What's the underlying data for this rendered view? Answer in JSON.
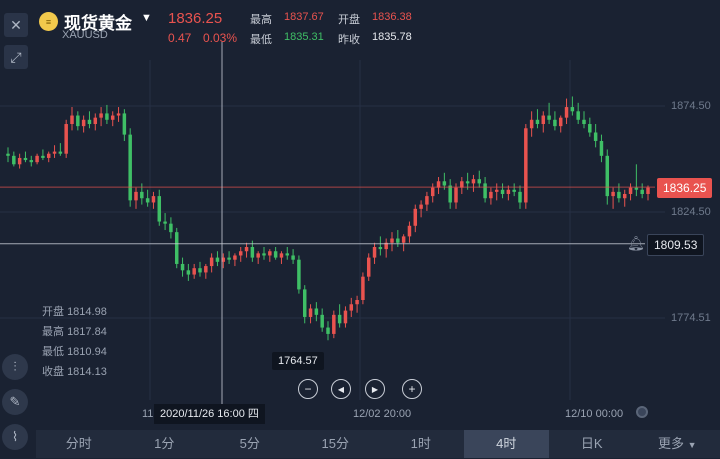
{
  "header": {
    "title": "现货黄金",
    "symbol": "XAUUSD",
    "price": "1836.25",
    "change": "0.47",
    "change_pct": "0.03%",
    "high_label": "最高",
    "high_value": "1837.67",
    "open_label": "开盘",
    "open_value": "1836.38",
    "low_label": "最低",
    "low_value": "1835.31",
    "prev_close_label": "昨收",
    "prev_close_value": "1835.78"
  },
  "colors": {
    "up": "#e9534f",
    "down": "#3fbf66",
    "background": "#1a2232",
    "accent_tag": "#e9534f"
  },
  "icons": {
    "close": "close-icon",
    "expand": "expand-icon",
    "candle_tool": "candlestick-icon",
    "draw_tool": "pencil-icon",
    "indicator_tool": "indicator-icon",
    "alert": "bell-icon"
  },
  "crosshair": {
    "low_tag": "1764.57",
    "date_tag": "2020/11/26 16:00 四",
    "price_tag": "1809.53",
    "ohlc": [
      {
        "label": "开盘",
        "value": "1814.98"
      },
      {
        "label": "最高",
        "value": "1817.84"
      },
      {
        "label": "最低",
        "value": "1810.94"
      },
      {
        "label": "收盘",
        "value": "1814.13"
      }
    ]
  },
  "current_price_tag": "1836.25",
  "chart_data": {
    "type": "candlestick",
    "y_ticks": [
      "1874.50",
      "1824.50",
      "1774.51"
    ],
    "y_tick_values": [
      1874.5,
      1824.5,
      1774.51
    ],
    "x_ticks": [
      "11",
      "12/02 20:00",
      "12/10 00:00"
    ],
    "candles": [
      [
        1852,
        1855,
        1848,
        1851
      ],
      [
        1851,
        1853,
        1846,
        1847
      ],
      [
        1847,
        1852,
        1845,
        1850
      ],
      [
        1850,
        1853,
        1848,
        1849
      ],
      [
        1849,
        1851,
        1846,
        1848
      ],
      [
        1848,
        1852,
        1847,
        1851
      ],
      [
        1851,
        1854,
        1849,
        1850
      ],
      [
        1850,
        1853,
        1848,
        1852
      ],
      [
        1852,
        1856,
        1850,
        1853
      ],
      [
        1853,
        1857,
        1851,
        1852
      ],
      [
        1852,
        1868,
        1850,
        1866
      ],
      [
        1866,
        1874,
        1863,
        1870
      ],
      [
        1870,
        1872,
        1863,
        1865
      ],
      [
        1865,
        1870,
        1862,
        1868
      ],
      [
        1868,
        1872,
        1864,
        1866
      ],
      [
        1866,
        1871,
        1863,
        1869
      ],
      [
        1869,
        1874,
        1865,
        1871
      ],
      [
        1871,
        1875,
        1866,
        1868
      ],
      [
        1868,
        1872,
        1865,
        1870
      ],
      [
        1870,
        1874,
        1867,
        1871
      ],
      [
        1871,
        1873,
        1858,
        1861
      ],
      [
        1861,
        1864,
        1827,
        1830
      ],
      [
        1830,
        1836,
        1826,
        1834
      ],
      [
        1834,
        1838,
        1828,
        1831
      ],
      [
        1831,
        1835,
        1827,
        1829
      ],
      [
        1829,
        1834,
        1826,
        1832
      ],
      [
        1832,
        1835,
        1818,
        1820
      ],
      [
        1820,
        1824,
        1816,
        1819
      ],
      [
        1819,
        1822,
        1812,
        1815
      ],
      [
        1815,
        1817,
        1798,
        1800
      ],
      [
        1800,
        1803,
        1794,
        1797
      ],
      [
        1797,
        1800,
        1792,
        1795
      ],
      [
        1795,
        1800,
        1793,
        1798
      ],
      [
        1798,
        1801,
        1794,
        1796
      ],
      [
        1796,
        1800,
        1793,
        1799
      ],
      [
        1799,
        1805,
        1796,
        1803
      ],
      [
        1803,
        1806,
        1799,
        1801
      ],
      [
        1801,
        1805,
        1798,
        1803
      ],
      [
        1803,
        1806,
        1800,
        1802
      ],
      [
        1802,
        1805,
        1799,
        1804
      ],
      [
        1804,
        1808,
        1801,
        1806
      ],
      [
        1806,
        1810,
        1803,
        1808
      ],
      [
        1808,
        1811,
        1801,
        1803
      ],
      [
        1803,
        1806,
        1800,
        1805
      ],
      [
        1805,
        1808,
        1802,
        1804
      ],
      [
        1804,
        1807,
        1801,
        1806
      ],
      [
        1806,
        1808,
        1802,
        1803
      ],
      [
        1803,
        1806,
        1800,
        1805
      ],
      [
        1805,
        1808,
        1802,
        1804
      ],
      [
        1804,
        1807,
        1800,
        1802
      ],
      [
        1802,
        1804,
        1786,
        1788
      ],
      [
        1788,
        1790,
        1772,
        1775
      ],
      [
        1775,
        1781,
        1772,
        1779
      ],
      [
        1779,
        1782,
        1773,
        1776
      ],
      [
        1776,
        1779,
        1768,
        1770
      ],
      [
        1770,
        1773,
        1764,
        1767
      ],
      [
        1767,
        1778,
        1765,
        1776
      ],
      [
        1776,
        1781,
        1770,
        1772
      ],
      [
        1772,
        1780,
        1770,
        1778
      ],
      [
        1778,
        1784,
        1775,
        1781
      ],
      [
        1781,
        1785,
        1777,
        1783
      ],
      [
        1783,
        1796,
        1781,
        1794
      ],
      [
        1794,
        1805,
        1792,
        1803
      ],
      [
        1803,
        1810,
        1800,
        1808
      ],
      [
        1808,
        1813,
        1804,
        1807
      ],
      [
        1807,
        1812,
        1803,
        1810
      ],
      [
        1810,
        1815,
        1806,
        1812
      ],
      [
        1812,
        1816,
        1808,
        1810
      ],
      [
        1810,
        1814,
        1806,
        1813
      ],
      [
        1813,
        1820,
        1810,
        1818
      ],
      [
        1818,
        1828,
        1815,
        1826
      ],
      [
        1826,
        1830,
        1822,
        1828
      ],
      [
        1828,
        1834,
        1825,
        1832
      ],
      [
        1832,
        1838,
        1829,
        1836
      ],
      [
        1836,
        1841,
        1833,
        1839
      ],
      [
        1839,
        1843,
        1835,
        1837
      ],
      [
        1837,
        1840,
        1826,
        1829
      ],
      [
        1829,
        1838,
        1826,
        1836
      ],
      [
        1836,
        1841,
        1833,
        1839
      ],
      [
        1839,
        1843,
        1835,
        1838
      ],
      [
        1838,
        1842,
        1834,
        1840
      ],
      [
        1840,
        1844,
        1836,
        1838
      ],
      [
        1838,
        1841,
        1829,
        1831
      ],
      [
        1831,
        1836,
        1828,
        1834
      ],
      [
        1834,
        1838,
        1830,
        1835
      ],
      [
        1835,
        1838,
        1831,
        1833
      ],
      [
        1833,
        1837,
        1830,
        1835
      ],
      [
        1835,
        1838,
        1832,
        1834
      ],
      [
        1834,
        1837,
        1826,
        1829
      ],
      [
        1829,
        1866,
        1826,
        1864
      ],
      [
        1864,
        1872,
        1860,
        1868
      ],
      [
        1868,
        1873,
        1864,
        1866
      ],
      [
        1866,
        1872,
        1862,
        1870
      ],
      [
        1870,
        1876,
        1866,
        1868
      ],
      [
        1868,
        1872,
        1863,
        1865
      ],
      [
        1865,
        1870,
        1862,
        1869
      ],
      [
        1869,
        1878,
        1866,
        1874
      ],
      [
        1874,
        1879,
        1870,
        1872
      ],
      [
        1872,
        1876,
        1866,
        1868
      ],
      [
        1868,
        1872,
        1864,
        1866
      ],
      [
        1866,
        1869,
        1860,
        1862
      ],
      [
        1862,
        1866,
        1855,
        1858
      ],
      [
        1858,
        1861,
        1848,
        1851
      ],
      [
        1851,
        1854,
        1828,
        1832
      ],
      [
        1832,
        1836,
        1826,
        1834
      ],
      [
        1834,
        1838,
        1829,
        1831
      ],
      [
        1831,
        1835,
        1827,
        1833
      ],
      [
        1833,
        1838,
        1830,
        1836
      ],
      [
        1836,
        1847,
        1832,
        1835
      ],
      [
        1835,
        1838,
        1831,
        1833
      ],
      [
        1833,
        1837,
        1830,
        1836
      ]
    ]
  },
  "nav": {
    "zoom_out": "−",
    "prev": "◀",
    "next": "▶",
    "zoom_in": "+"
  },
  "tabs": [
    "分时",
    "1分",
    "5分",
    "15分",
    "1时",
    "4时",
    "日K",
    "更多"
  ]
}
